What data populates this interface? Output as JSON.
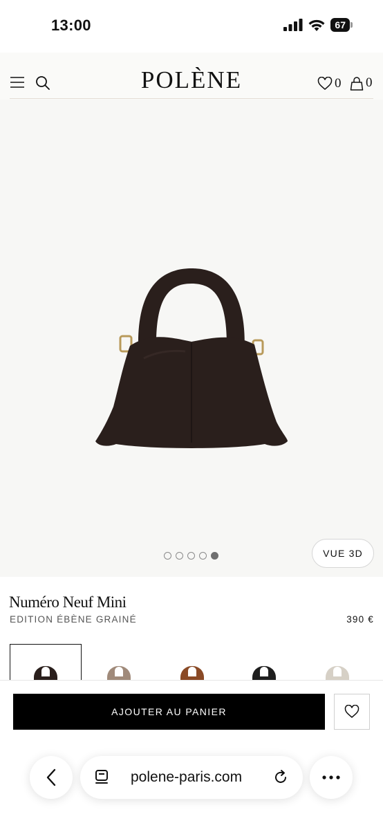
{
  "status_bar": {
    "time": "13:00",
    "battery": "67"
  },
  "header": {
    "logo": "POLÈNE",
    "wishlist_count": "0",
    "cart_count": "0"
  },
  "gallery": {
    "vue3d_label": "VUE 3D",
    "image_count": 5,
    "active_index": 4,
    "bag_color": "#2a1f1c"
  },
  "product": {
    "name": "Numéro Neuf Mini",
    "edition": "EDITION ÉBÈNE GRAINÉ",
    "price": "390 €",
    "swatches": [
      {
        "color": "#2a1f1c",
        "selected": true
      },
      {
        "color": "#a08a7a",
        "selected": false
      },
      {
        "color": "#8a4a26",
        "selected": false
      },
      {
        "color": "#1f1f1f",
        "selected": false
      },
      {
        "color": "#d6d0c6",
        "selected": false
      }
    ]
  },
  "actions": {
    "add_to_cart": "AJOUTER AU PANIER"
  },
  "browser": {
    "url": "polene-paris.com"
  }
}
